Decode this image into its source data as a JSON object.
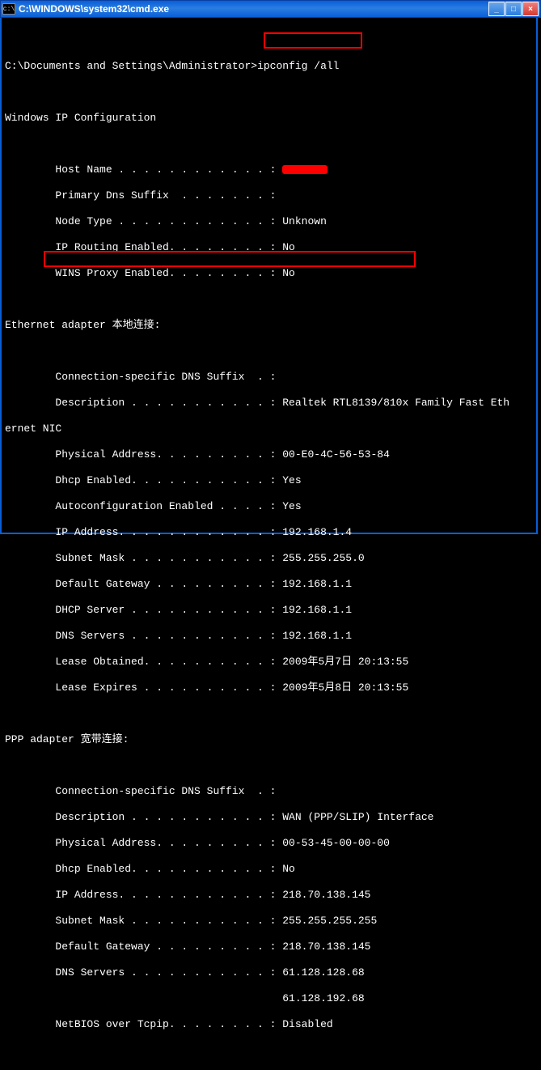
{
  "window": {
    "title": "C:\\WINDOWS\\system32\\cmd.exe",
    "icon_label": "cmd-icon",
    "buttons": {
      "min": "_",
      "max": "□",
      "close": "×"
    }
  },
  "highlight": {
    "cmd": "ipconfig /all",
    "mac": "00-E0-4C-56-53-84"
  },
  "lines": {
    "l0": "",
    "prompt": "C:\\Documents and Settings\\Administrator>",
    "l2": "",
    "l3": "Windows IP Configuration",
    "l4": "",
    "host_label": "        Host Name . . . . . . . . . . . . : ",
    "primary_dns": "        Primary Dns Suffix  . . . . . . . :",
    "node_type": "        Node Type . . . . . . . . . . . . : Unknown",
    "ip_routing": "        IP Routing Enabled. . . . . . . . : No",
    "wins_proxy": "        WINS Proxy Enabled. . . . . . . . : No",
    "l10": "",
    "eth_header": "Ethernet adapter 本地连接:",
    "l12": "",
    "eth_suffix": "        Connection-specific DNS Suffix  . :",
    "eth_desc": "        Description . . . . . . . . . . . : Realtek RTL8139/810x Family Fast Eth",
    "eth_desc2": "ernet NIC",
    "eth_phys": "        Physical Address. . . . . . . . . : 00-E0-4C-56-53-84",
    "eth_dhcp": "        Dhcp Enabled. . . . . . . . . . . : Yes",
    "eth_auto": "        Autoconfiguration Enabled . . . . : Yes",
    "eth_ip": "        IP Address. . . . . . . . . . . . : 192.168.1.4",
    "eth_mask": "        Subnet Mask . . . . . . . . . . . : 255.255.255.0",
    "eth_gw": "        Default Gateway . . . . . . . . . : 192.168.1.1",
    "eth_dhcps": "        DHCP Server . . . . . . . . . . . : 192.168.1.1",
    "eth_dns": "        DNS Servers . . . . . . . . . . . : 192.168.1.1",
    "eth_lobt": "        Lease Obtained. . . . . . . . . . : 2009年5月7日 20:13:55",
    "eth_lexp": "        Lease Expires . . . . . . . . . . : 2009年5月8日 20:13:55",
    "l26": "",
    "ppp_header": "PPP adapter 宽带连接:",
    "l28": "",
    "ppp_suffix": "        Connection-specific DNS Suffix  . :",
    "ppp_desc": "        Description . . . . . . . . . . . : WAN (PPP/SLIP) Interface",
    "ppp_phys": "        Physical Address. . . . . . . . . : 00-53-45-00-00-00",
    "ppp_dhcp": "        Dhcp Enabled. . . . . . . . . . . : No",
    "ppp_ip": "        IP Address. . . . . . . . . . . . : 218.70.138.145",
    "ppp_mask": "        Subnet Mask . . . . . . . . . . . : 255.255.255.255",
    "ppp_gw": "        Default Gateway . . . . . . . . . : 218.70.138.145",
    "ppp_dns1": "        DNS Servers . . . . . . . . . . . : 61.128.128.68",
    "ppp_dns2": "                                            61.128.192.68",
    "ppp_nbt": "        NetBIOS over Tcpip. . . . . . . . : Disabled"
  }
}
